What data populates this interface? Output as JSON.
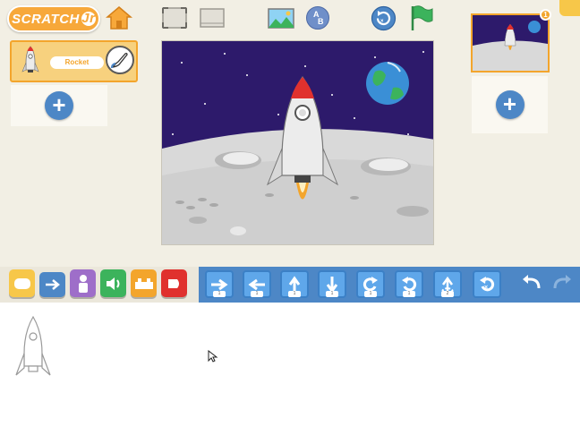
{
  "app": {
    "logo_text": "SCRATCH",
    "logo_suffix": "Jr"
  },
  "top_toolbar": {
    "icons": [
      "home-icon",
      "presentation-mode-icon",
      "grid-icon",
      "change-background-icon",
      "add-text-icon",
      "reset-characters-icon",
      "green-flag-icon"
    ]
  },
  "sprite": {
    "name": "Rocket"
  },
  "pages": {
    "current_badge": "1",
    "add_icon": "plus-icon"
  },
  "categories": [
    {
      "name": "triggering",
      "color": "#f7c749"
    },
    {
      "name": "motion",
      "color": "#4d87c6"
    },
    {
      "name": "looks",
      "color": "#9e6ec9"
    },
    {
      "name": "sound",
      "color": "#3cb35c"
    },
    {
      "name": "control",
      "color": "#f3a52c"
    },
    {
      "name": "end",
      "color": "#e0312e"
    }
  ],
  "motion_blocks": [
    {
      "name": "move-right",
      "value": "1"
    },
    {
      "name": "move-left",
      "value": "1"
    },
    {
      "name": "move-up",
      "value": "1"
    },
    {
      "name": "move-down",
      "value": "1"
    },
    {
      "name": "turn-right",
      "value": "1"
    },
    {
      "name": "turn-left",
      "value": "1"
    },
    {
      "name": "hop",
      "value": "2"
    },
    {
      "name": "go-home",
      "value": ""
    }
  ],
  "edit_controls": [
    "undo-icon",
    "redo-icon"
  ],
  "colors": {
    "sky": "#2d1a6b",
    "accent_orange": "#f3a52c",
    "motion_blue": "#4d87c6"
  }
}
